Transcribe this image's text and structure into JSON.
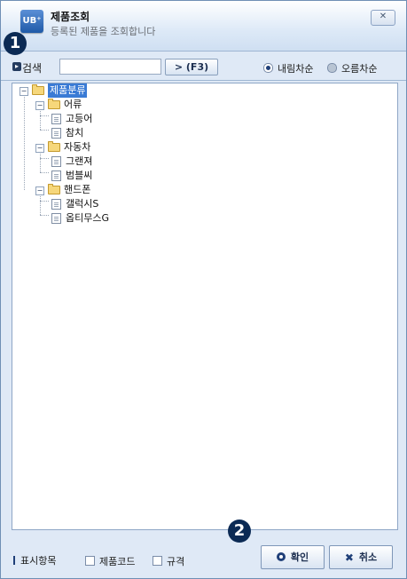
{
  "header": {
    "logo_text": "UB⁺",
    "title": "제품조회",
    "subtitle": "등록된 제품을 조회합니다",
    "close_label": "✕"
  },
  "badges": [
    "1",
    "2"
  ],
  "search": {
    "label": "검색",
    "value": "",
    "placeholder": "",
    "button_label": "> (F3)"
  },
  "sort": {
    "options": [
      "내림차순",
      "오름차순"
    ],
    "selected": "내림차순"
  },
  "tree": {
    "root": "제품분류",
    "groups": [
      {
        "label": "어류",
        "items": [
          "고등어",
          "참치"
        ]
      },
      {
        "label": "자동차",
        "items": [
          "그랜져",
          "범블씨"
        ]
      },
      {
        "label": "핸드폰",
        "items": [
          "갤럭시S",
          "옵티무스G"
        ]
      }
    ]
  },
  "footer": {
    "display_label": "표시항목",
    "checkboxes": [
      "제품코드",
      "규격"
    ],
    "ok_label": "확인",
    "cancel_label": "취소"
  },
  "colors": {
    "accent": "#1f3f78",
    "selected": "#3a7bd5",
    "panel_bg": "#dfe9f6"
  }
}
